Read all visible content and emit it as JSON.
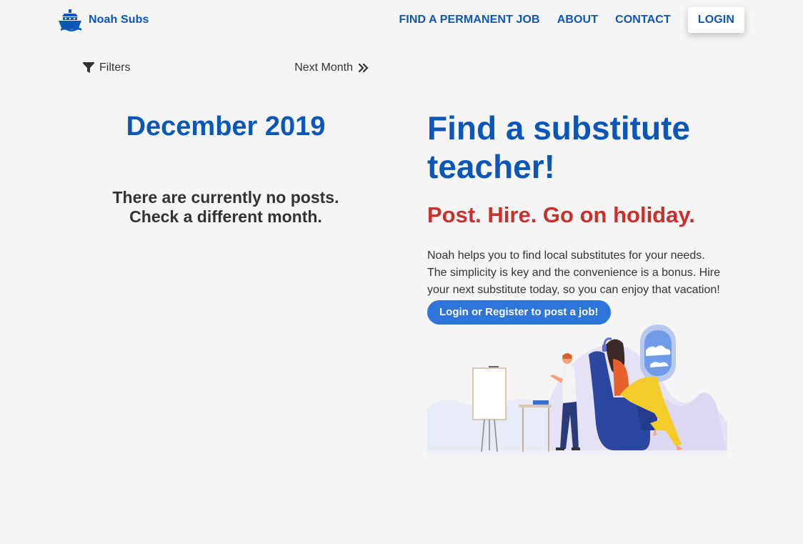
{
  "brand": {
    "name": "Noah Subs",
    "logo_icon": "ark-ship-icon"
  },
  "nav": {
    "items": [
      {
        "label": "FIND A PERMANENT JOB"
      },
      {
        "label": "ABOUT"
      },
      {
        "label": "CONTACT"
      }
    ],
    "login_label": "LOGIN"
  },
  "calendar": {
    "filters_label": "Filters",
    "filters_icon": "filter-icon",
    "next_month_label": "Next Month",
    "next_month_icon": "double-chevron-right-icon",
    "month_title": "December 2019",
    "empty_message_line1": "There are currently no posts.",
    "empty_message_line2": "Check a different month."
  },
  "hero": {
    "title": "Find a substitute teacher!",
    "subtitle": "Post. Hire. Go on holiday.",
    "description": "Noah helps you to find local substitutes for your needs. The simplicity is key and the convenience is a bonus. Hire your next substitute today, so you can enjoy that vacation!",
    "cta_label": "Login or Register to post a job!"
  },
  "colors": {
    "brand_blue": "#0b57b8",
    "accent_red": "#c9302c",
    "cta_blue": "#2f74d8",
    "background": "#f5f5f5",
    "text": "#333333"
  }
}
